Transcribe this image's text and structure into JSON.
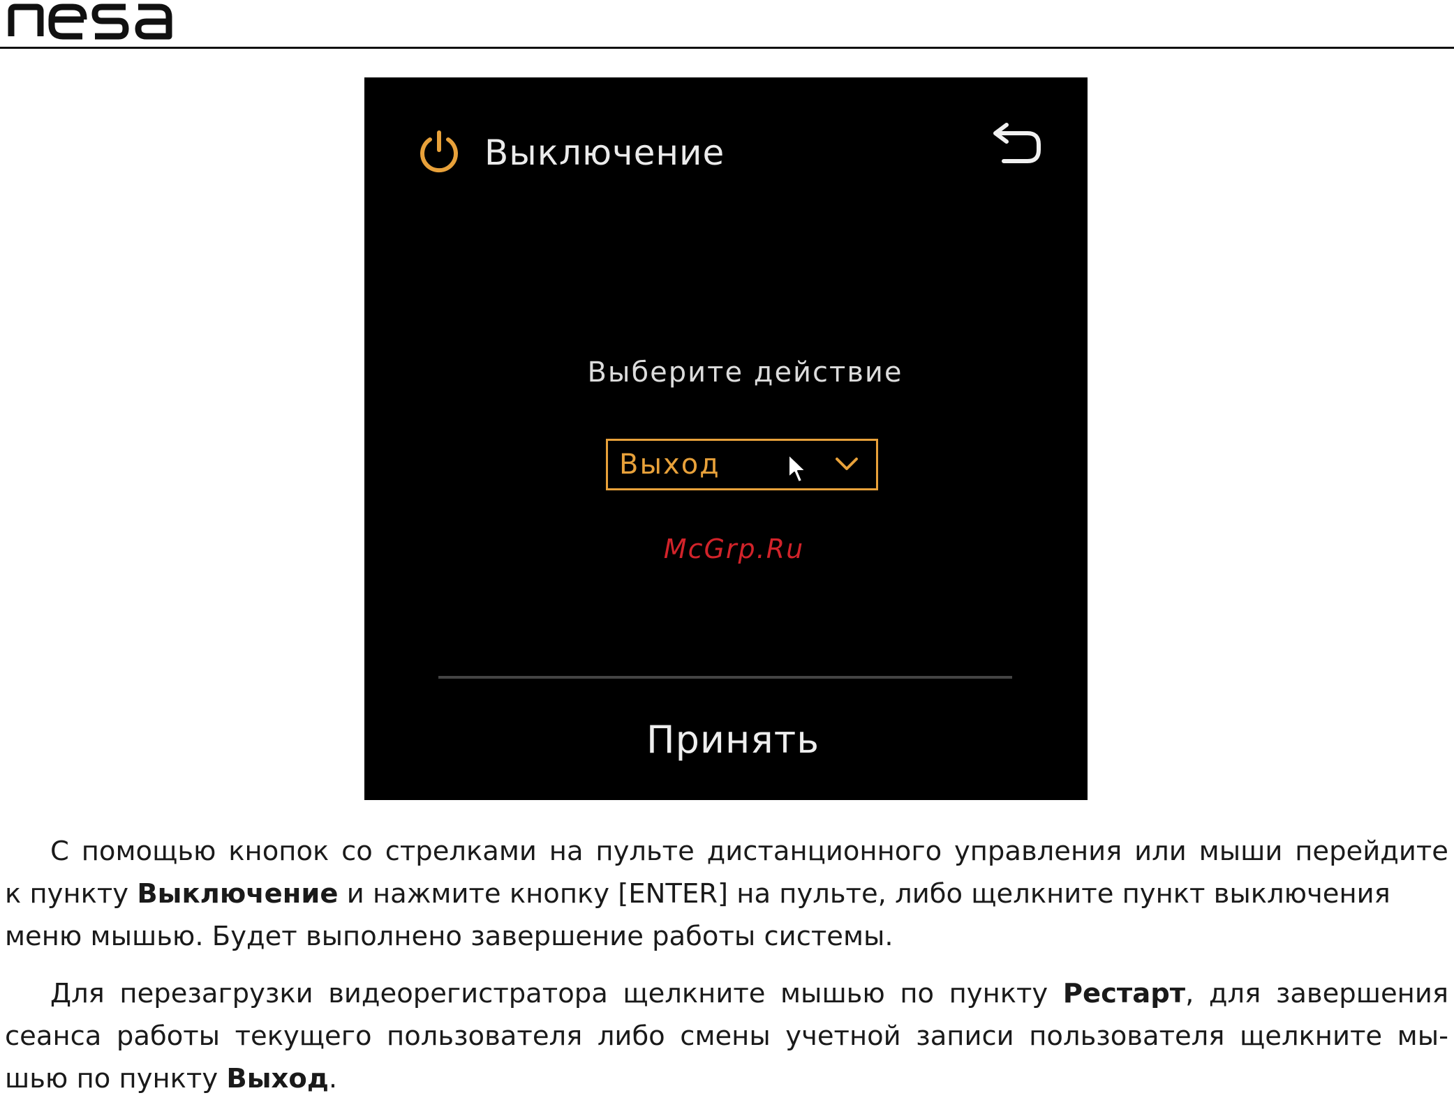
{
  "header": {
    "logo": "nesa"
  },
  "dialog": {
    "title": "Выключение",
    "icons": {
      "title": "power-icon",
      "back": "back-arrow-icon",
      "dropdown": "chevron-down-icon",
      "pointer": "mouse-cursor-icon"
    },
    "prompt": "Выберите действие",
    "dropdown_value": "Выход",
    "watermark": "McGrp.Ru",
    "accept_label": "Принять",
    "colors": {
      "background": "#000000",
      "accent": "#e8a13a",
      "text": "#ebebeb",
      "watermark": "#d2232a"
    }
  },
  "body": {
    "p1": {
      "l1": "С помощью кнопок со стрелками на пульте дистанционного управления или мыши перейдите",
      "l2a": "к пункту ",
      "l2b": "Выключение",
      "l2c": " и нажмите кнопку [ENTER] на пульте, либо щелкните пункт выключения",
      "l3": "меню мышью. Будет выполнено завершение работы системы."
    },
    "p2": {
      "l1a": "Для перезагрузки видеорегистратора щелкните мышью по пункту ",
      "l1b": "Рестарт",
      "l1c": ", для завершения",
      "l2": "сеанса работы текущего пользователя либо смены учетной записи пользователя щелкните мы-",
      "l3a": "шью по пункту ",
      "l3b": "Выход",
      "l3c": "."
    }
  }
}
